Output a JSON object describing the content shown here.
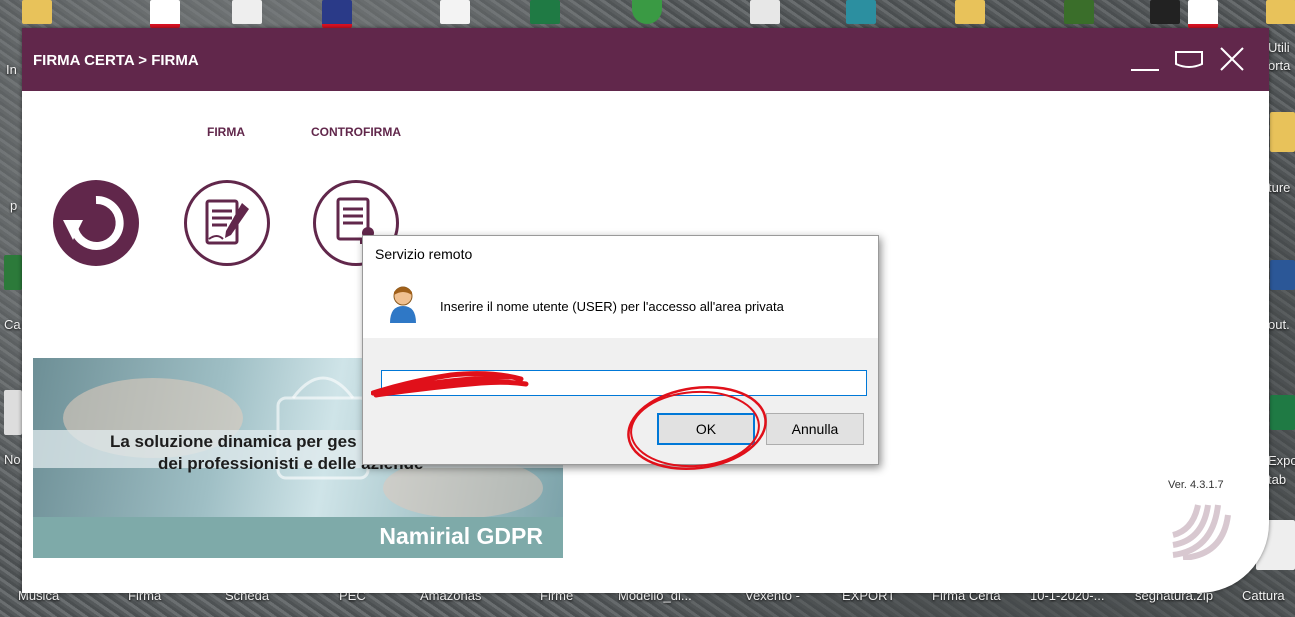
{
  "window": {
    "title": "FIRMA CERTA > FIRMA",
    "tabs": {
      "firma": "FIRMA",
      "controfirma": "CONTROFIRMA"
    },
    "version": "Ver. 4.3.1.7",
    "banner": {
      "line1": "La soluzione dinamica per ges",
      "line2": "dei professionisti e delle aziende",
      "brand": "Namirial GDPR"
    }
  },
  "dialog": {
    "title": "Servizio remoto",
    "message": "Inserire il nome utente (USER) per l'accesso all'area privata",
    "input_value": "",
    "ok_label": "OK",
    "cancel_label": "Annulla"
  },
  "desktop": {
    "left_labels": [
      "In",
      "p",
      "Ca",
      "No"
    ],
    "right_labels": [
      "Utili",
      "orta",
      "ture",
      "out.",
      "Expo",
      "tab"
    ],
    "bottom_labels": [
      "Musica",
      "Firma",
      "Scheda",
      "PEC",
      "Amazonas",
      "Firme",
      "Modello_di...",
      "Vexento -",
      "EXPORT",
      "Firma Certa",
      "10-1-2020-...",
      "segnatura.zip",
      "Cattura"
    ]
  },
  "colors": {
    "brand": "#61274b",
    "focus": "#0078d7",
    "annotation": "#e0101a"
  }
}
